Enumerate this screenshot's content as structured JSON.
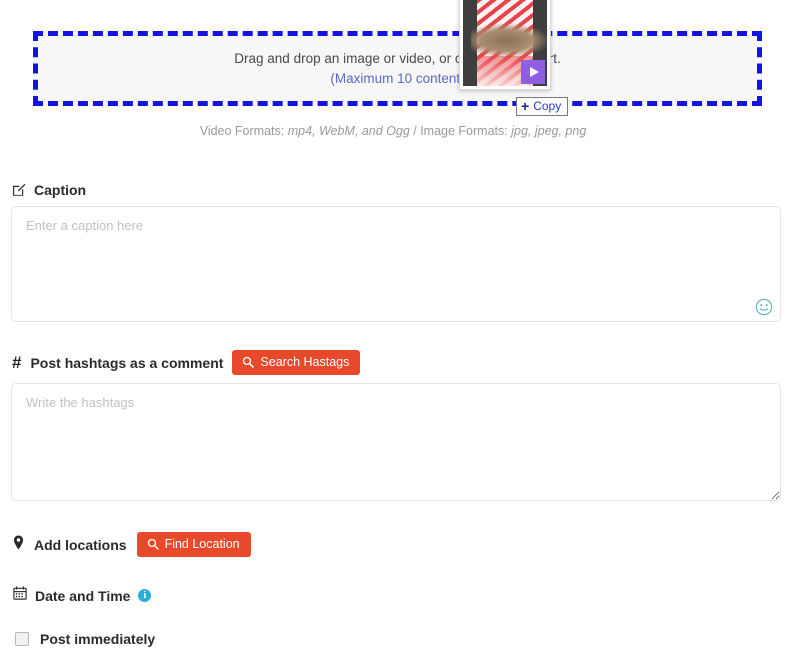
{
  "dropzone": {
    "line1": "Drag and drop an image or video, or click here to start.",
    "line2": "(Maximum 10 content)",
    "border_color": "#1414e0",
    "fill_color": "#f7f7f7"
  },
  "formats_note": {
    "video_label": "Video Formats:",
    "video_values": "mp4, WebM, and Ogg",
    "separator": " / ",
    "image_label": "Image Formats:",
    "image_values": "jpg, jpeg, png"
  },
  "caption": {
    "icon": "edit-pencil-icon",
    "title": "Caption",
    "placeholder": "Enter a caption here",
    "value": "",
    "emoji_icon": "smiley-emoji-icon",
    "emoji_color": "#6fb6bd"
  },
  "hashtags": {
    "icon": "hash-icon",
    "hash_symbol": "#",
    "title": "Post hashtags as a comment",
    "search_button": {
      "icon": "search-icon",
      "label": "Search Hastags",
      "color": "#e8492b"
    },
    "placeholder": "Write the hashtags",
    "value": ""
  },
  "locations": {
    "icon": "map-pin-icon",
    "title": "Add locations",
    "find_button": {
      "icon": "search-icon",
      "label": "Find Location",
      "color": "#e8492b"
    }
  },
  "date_time": {
    "icon": "calendar-icon",
    "title": "Date and Time",
    "info_icon": "info-circle-icon",
    "info_glyph": "i",
    "info_color": "#29aedb"
  },
  "post_immediately": {
    "label": "Post immediately",
    "checked": false
  },
  "drag_ghost": {
    "name": "drag-preview-thumbnail",
    "media_type": "video",
    "play_icon": "play-triangle-icon",
    "play_badge_color": "#8e5fe0"
  },
  "copy_hint": {
    "plus": "+",
    "label": "Copy",
    "text_color": "#1b3fd0"
  }
}
